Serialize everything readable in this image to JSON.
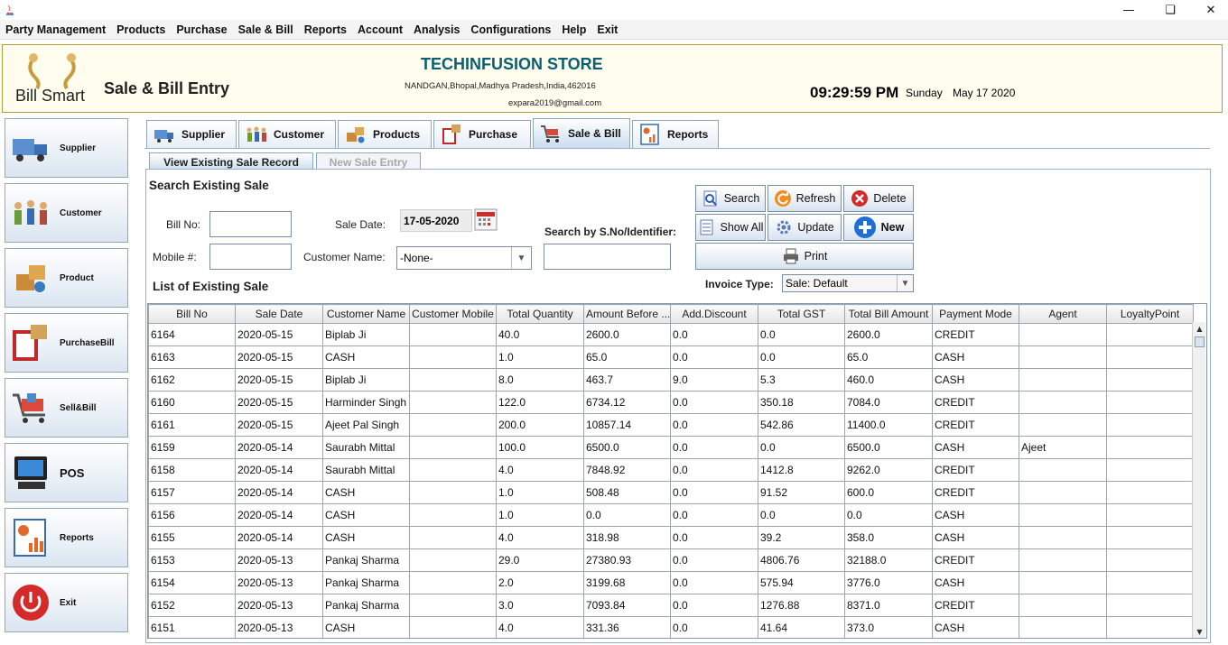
{
  "menu": [
    "Party Management",
    "Products",
    "Purchase",
    "Sale & Bill",
    "Reports",
    "Account",
    "Analysis",
    "Configurations",
    "Help",
    "Exit"
  ],
  "header": {
    "logo_text": "Bill Smart",
    "page_title": "Sale & Bill Entry",
    "store_name": "TECHINFUSION STORE",
    "store_address": "NANDGAN,Bhopal,Madhya Pradesh,India,462016",
    "store_email": "expara2019@gmail.com",
    "time": "09:29:59 PM",
    "day": "Sunday",
    "date": "May 17 2020"
  },
  "sidebar": [
    {
      "label": "Supplier",
      "icon": "delivery-truck-icon"
    },
    {
      "label": "Customer",
      "icon": "people-icon"
    },
    {
      "label": "Product",
      "icon": "product-boxes-icon"
    },
    {
      "label": "PurchaseBill",
      "icon": "purchase-bill-icon"
    },
    {
      "label": "Sell&Bill",
      "icon": "shopping-cart-icon"
    },
    {
      "label": "POS",
      "icon": "pos-terminal-icon"
    },
    {
      "label": "Reports",
      "icon": "report-chart-icon"
    },
    {
      "label": "Exit",
      "icon": "power-icon"
    }
  ],
  "tabs": [
    {
      "label": "Supplier",
      "icon": "delivery-truck-icon"
    },
    {
      "label": "Customer",
      "icon": "people-icon"
    },
    {
      "label": "Products",
      "icon": "product-boxes-icon"
    },
    {
      "label": "Purchase",
      "icon": "purchase-bill-icon"
    },
    {
      "label": "Sale & Bill",
      "icon": "shopping-cart-icon",
      "active": true
    },
    {
      "label": "Reports",
      "icon": "report-chart-icon"
    }
  ],
  "subtabs": [
    "View Existing Sale Record",
    "New Sale Entry"
  ],
  "search": {
    "heading": "Search Existing Sale",
    "bill_no_label": "Bill No:",
    "bill_no_value": "",
    "mobile_label": "Mobile #:",
    "mobile_value": "",
    "sale_date_label": "Sale Date:",
    "sale_date_value": "17-05-2020",
    "customer_name_label": "Customer Name:",
    "customer_name_value": "-None-",
    "identifier_label": "Search by S.No/Identifier:",
    "identifier_value": ""
  },
  "actions": {
    "search": "Search",
    "refresh": "Refresh",
    "delete": "Delete",
    "show_all": "Show All",
    "update": "Update",
    "new": "New",
    "print": "Print",
    "invoice_type_label": "Invoice Type:",
    "invoice_type_value": "Sale: Default"
  },
  "list_heading": "List of Existing Sale",
  "table": {
    "columns": [
      "Bill No",
      "Sale Date",
      "Customer Name",
      "Customer Mobile",
      "Total Quantity",
      "Amount Before ...",
      "Add.Discount",
      "Total GST",
      "Total Bill Amount",
      "Payment Mode",
      "Agent",
      "LoyaltyPoint"
    ],
    "rows": [
      [
        "6164",
        "2020-05-15",
        "Biplab Ji",
        "",
        "40.0",
        "2600.0",
        "0.0",
        "0.0",
        "2600.0",
        "CREDIT",
        "",
        ""
      ],
      [
        "6163",
        "2020-05-15",
        "CASH",
        "",
        "1.0",
        "65.0",
        "0.0",
        "0.0",
        "65.0",
        "CASH",
        "",
        ""
      ],
      [
        "6162",
        "2020-05-15",
        "Biplab Ji",
        "",
        "8.0",
        "463.7",
        "9.0",
        "5.3",
        "460.0",
        "CASH",
        "",
        ""
      ],
      [
        "6160",
        "2020-05-15",
        "Harminder Singh",
        "",
        "122.0",
        "6734.12",
        "0.0",
        "350.18",
        "7084.0",
        "CREDIT",
        "",
        ""
      ],
      [
        "6161",
        "2020-05-15",
        "Ajeet Pal Singh",
        "",
        "200.0",
        "10857.14",
        "0.0",
        "542.86",
        "11400.0",
        "CREDIT",
        "",
        ""
      ],
      [
        "6159",
        "2020-05-14",
        "Saurabh Mittal",
        "",
        "100.0",
        "6500.0",
        "0.0",
        "0.0",
        "6500.0",
        "CASH",
        "Ajeet",
        ""
      ],
      [
        "6158",
        "2020-05-14",
        "Saurabh Mittal",
        "",
        "4.0",
        "7848.92",
        "0.0",
        "1412.8",
        "9262.0",
        "CREDIT",
        "",
        ""
      ],
      [
        "6157",
        "2020-05-14",
        "CASH",
        "",
        "1.0",
        "508.48",
        "0.0",
        "91.52",
        "600.0",
        "CREDIT",
        "",
        ""
      ],
      [
        "6156",
        "2020-05-14",
        "CASH",
        "",
        "1.0",
        "0.0",
        "0.0",
        "0.0",
        "0.0",
        "CASH",
        "",
        ""
      ],
      [
        "6155",
        "2020-05-14",
        "CASH",
        "",
        "4.0",
        "318.98",
        "0.0",
        "39.2",
        "358.0",
        "CASH",
        "",
        ""
      ],
      [
        "6153",
        "2020-05-13",
        "Pankaj Sharma",
        "",
        "29.0",
        "27380.93",
        "0.0",
        "4806.76",
        "32188.0",
        "CREDIT",
        "",
        ""
      ],
      [
        "6154",
        "2020-05-13",
        "Pankaj Sharma",
        "",
        "2.0",
        "3199.68",
        "0.0",
        "575.94",
        "3776.0",
        "CASH",
        "",
        ""
      ],
      [
        "6152",
        "2020-05-13",
        "Pankaj Sharma",
        "",
        "3.0",
        "7093.84",
        "0.0",
        "1276.88",
        "8371.0",
        "CREDIT",
        "",
        ""
      ],
      [
        "6151",
        "2020-05-13",
        "CASH",
        "",
        "4.0",
        "331.36",
        "0.0",
        "41.64",
        "373.0",
        "CASH",
        "",
        ""
      ]
    ]
  },
  "colors": {
    "accent": "#0b5f6e",
    "header_bg": "#fffdee",
    "header_border": "#b59d33",
    "button_gradient_end": "#d9e4f0"
  }
}
